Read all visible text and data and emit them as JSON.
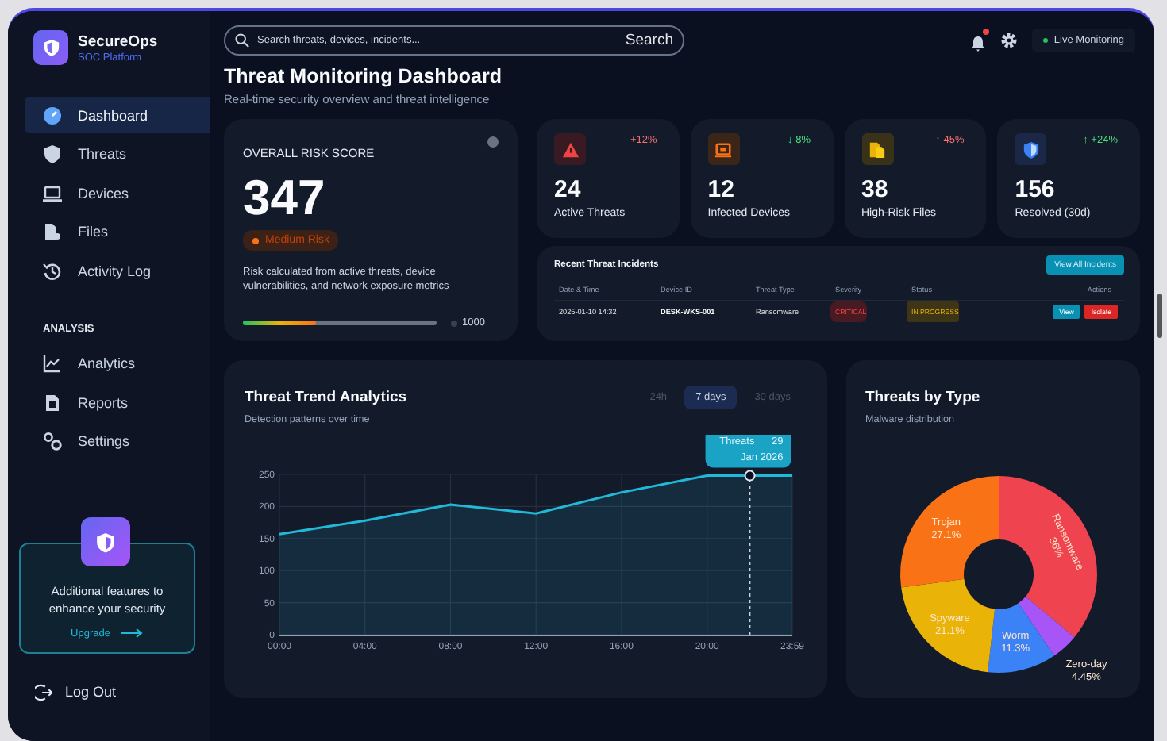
{
  "app": {
    "name": "SecureOps",
    "tagline": "SOC Platform"
  },
  "sidebar": {
    "items": [
      {
        "label": "Dashboard",
        "selected": true
      },
      {
        "label": "Threats",
        "selected": false
      },
      {
        "label": "Devices",
        "selected": false
      },
      {
        "label": "Files",
        "selected": false
      },
      {
        "label": "Activity Log",
        "selected": false
      }
    ],
    "section": "ANALYSIS",
    "analysis_items": [
      {
        "label": "Analytics",
        "selected": false
      },
      {
        "label": "Reports",
        "selected": false
      },
      {
        "label": "Settings",
        "selected": false
      }
    ],
    "upgrade": {
      "text": "Additional features to enhance your security",
      "link": "Upgrade"
    },
    "logout": "Log Out"
  },
  "topbar": {
    "search": {
      "placeholder": "Search threats, devices, incidents...",
      "button": "Search"
    },
    "unread_notifications": true,
    "status": "Live Monitoring"
  },
  "header": {
    "title": "Threat Monitoring Dashboard",
    "subtitle": "Real-time security overview and threat intelligence"
  },
  "risk": {
    "label": "OVERALL RISK SCORE",
    "score": "347",
    "badge": "Medium Risk",
    "description": "Risk calculated from active threats, device vulnerabilities, and network exposure metrics",
    "level": 0.38,
    "max": "1000"
  },
  "stats": [
    {
      "value": "24",
      "label": "Active Threats",
      "change": "+12%",
      "positive": false
    },
    {
      "value": "12",
      "label": "Infected Devices",
      "change": "↓ 8%",
      "positive": true
    },
    {
      "value": "38",
      "label": "High-Risk Files",
      "change": "↑ 45%",
      "positive": false
    },
    {
      "value": "156",
      "label": "Resolved (30d)",
      "change": "↑ +24%",
      "positive": true
    }
  ],
  "incidents": {
    "title": "Recent Threat Incidents",
    "button": "View All Incidents",
    "columns": [
      "Date & Time",
      "Device ID",
      "Threat Type",
      "Severity",
      "Status",
      "Actions"
    ],
    "rows": [
      {
        "date": "2025-01-10 14:32",
        "device": "DESK-WKS-001",
        "type": "Ransomware",
        "severity": "CRITICAL",
        "status": "IN PROGRESS",
        "actions": [
          "View",
          "Isolate"
        ]
      }
    ]
  },
  "trend": {
    "title": "Threat Trend Analytics",
    "subtitle": "Detection patterns over time",
    "ranges": [
      {
        "label": "24h",
        "selected": false
      },
      {
        "label": "7 days",
        "selected": true
      },
      {
        "label": "30 days",
        "selected": false
      }
    ],
    "chart_data": {
      "type": "area",
      "x": [
        0,
        4,
        8,
        12,
        16,
        20,
        23.983
      ],
      "series": [
        {
          "color": "#22b8d8",
          "values": [
            157,
            178,
            203,
            189,
            222,
            248,
            248
          ]
        }
      ],
      "xlim": [
        0,
        23.983
      ],
      "ylim": [
        0,
        250
      ],
      "grid": true,
      "xticks": [
        {
          "value": 0,
          "label": "00:00"
        },
        {
          "value": 4,
          "label": "04:00"
        },
        {
          "value": 8,
          "label": "08:00"
        },
        {
          "value": 12,
          "label": "12:00"
        },
        {
          "value": 16,
          "label": "16:00"
        },
        {
          "value": 20,
          "label": "20:00"
        },
        {
          "value": 23.983,
          "label": "23:59"
        }
      ],
      "yticks": [
        0,
        50,
        100,
        150,
        200,
        250
      ],
      "ref_lines": [
        {
          "axis": "x",
          "value": 22
        }
      ],
      "annotations": [
        {
          "x": 22,
          "y": 248,
          "text": "Threats 29 Jan 2026"
        }
      ]
    }
  },
  "types": {
    "title": "Threats by Type",
    "subtitle": "Malware distribution",
    "chart_data": {
      "type": "donut",
      "categories": [
        "Ransomware",
        "Zero-day",
        "Worm",
        "Spyware",
        "Trojan"
      ],
      "values": [
        36,
        4.45,
        11.3,
        21.1,
        27.1
      ],
      "colors": [
        "#ef4450",
        "#a855f7",
        "#3b82f6",
        "#eab308",
        "#f97316"
      ],
      "value_labels": [
        "36%",
        "4.45%",
        "11.3%",
        "21.1%",
        "27.1%"
      ]
    }
  }
}
